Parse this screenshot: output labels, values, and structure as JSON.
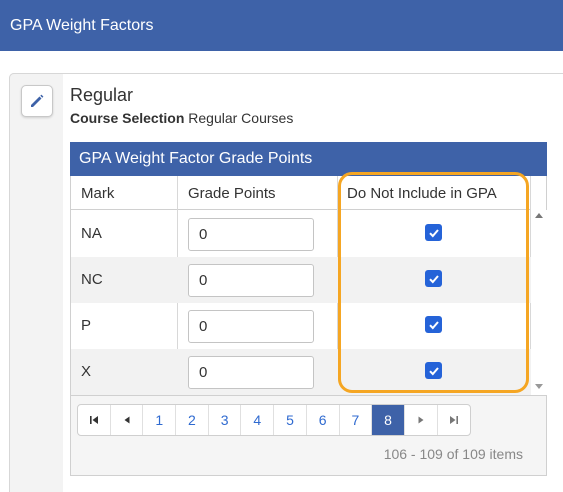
{
  "window": {
    "title": "GPA Weight Factors"
  },
  "record": {
    "title": "Regular",
    "course_selection_label": "Course Selection",
    "course_selection_value": "Regular Courses"
  },
  "grid": {
    "title": "GPA Weight Factor Grade Points",
    "columns": [
      "Mark",
      "Grade Points",
      "Do Not Include in GPA"
    ],
    "rows": [
      {
        "mark": "NA",
        "grade_points": "0",
        "exclude": true
      },
      {
        "mark": "NC",
        "grade_points": "0",
        "exclude": true
      },
      {
        "mark": "P",
        "grade_points": "0",
        "exclude": true
      },
      {
        "mark": "X",
        "grade_points": "0",
        "exclude": true
      }
    ]
  },
  "pager": {
    "pages": [
      "1",
      "2",
      "3",
      "4",
      "5",
      "6",
      "7",
      "8"
    ],
    "current": "8",
    "info": "106 - 109 of 109 items"
  },
  "colors": {
    "header": "#3e62a8",
    "checkbox": "#2563d8",
    "highlight": "#f5a623"
  },
  "icons": {
    "edit": "pencil-icon",
    "first": "first-page-icon",
    "prev": "prev-page-icon",
    "next": "next-page-icon",
    "last": "last-page-icon"
  }
}
